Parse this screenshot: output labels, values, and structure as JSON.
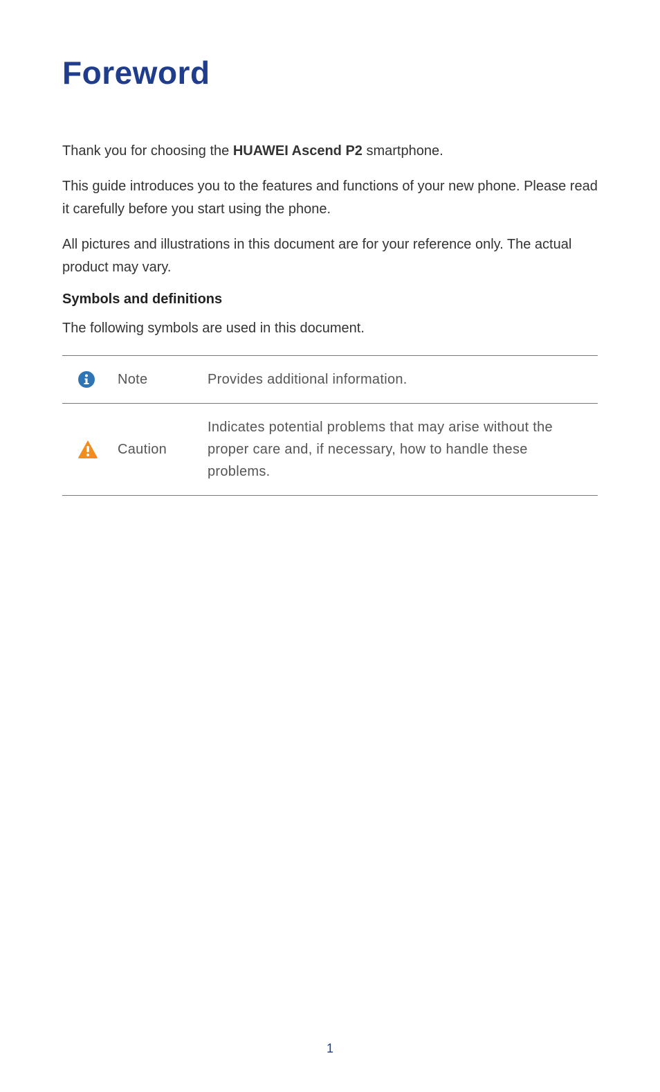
{
  "title": "Foreword",
  "paragraphs": {
    "p1_pre": "Thank you for choosing the ",
    "p1_bold": "HUAWEI Ascend P2",
    "p1_post": "  smartphone.",
    "p2": "This guide introduces you to the features and functions of your new phone. Please read it carefully before you start using the phone.",
    "p3": "All pictures and illustrations in this document are for your reference only. The actual product may vary."
  },
  "subhead": "Symbols and definitions",
  "symbols_intro": "The following symbols are used in this document.",
  "table": {
    "rows": [
      {
        "icon": "info",
        "label": "Note",
        "desc": "Provides additional information."
      },
      {
        "icon": "caution",
        "label": "Caution",
        "desc": "Indicates potential problems that may arise without the proper care and, if necessary, how to handle these problems."
      }
    ]
  },
  "page_number": "1",
  "colors": {
    "brand_blue": "#1f3d8a",
    "info_icon": "#2f74b5",
    "caution_icon": "#f28c1d"
  }
}
